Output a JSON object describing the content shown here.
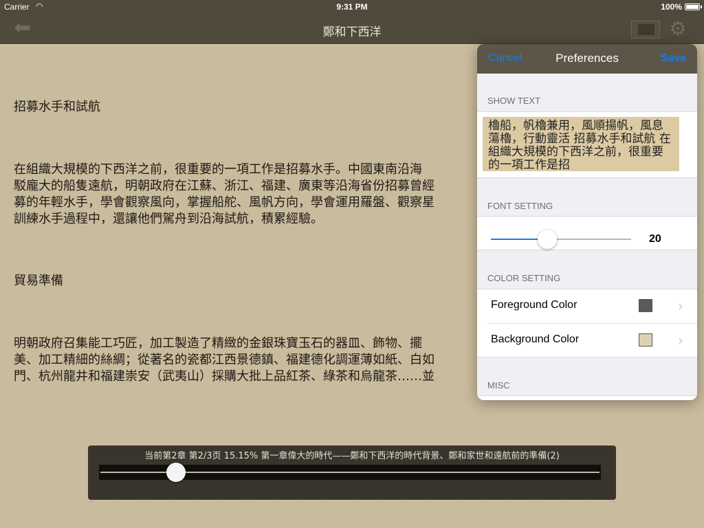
{
  "status_bar": {
    "carrier": "Carrier",
    "time": "9:31 PM",
    "battery": "100%"
  },
  "navbar": {
    "title": "鄭和下西洋"
  },
  "content": {
    "paragraphs": [
      "招募水手和試航",
      "在組織大規模的下西洋之前，很重要的一項工作是招募水手。中國東南沿海",
      "駁龐大的船隻遠航，明朝政府在江蘇、浙江、福建、廣東等沿海省份招募曾經",
      "募的年輕水手，學會觀察風向，掌握船舵、風帆方向，學會運用羅盤、觀察星",
      "訓練水手過程中，還讓他們駕舟到沿海試航，積累經驗。",
      "貿易準備",
      "明朝政府召集能工巧匠，加工製造了精緻的金銀珠寶玉石的器皿、飾物、擺",
      "美、加工精細的絲綢；從著名的瓷都江西景德鎮、福建德化調運薄如紙、白如",
      "門、杭州龍井和福建崇安（武夷山）採購大批上品紅茶、綠茶和烏龍茶……並"
    ]
  },
  "progress": {
    "label": "当前第2章 第2/3页 15.15% 第一章偉大的時代——鄭和下西洋的時代背景、鄭和家世和遠航前的準備(2)",
    "value": 0.1515
  },
  "preferences": {
    "title": "Preferences",
    "cancel_label": "Cancel",
    "save_label": "Save",
    "show_text_header": "SHOW TEXT",
    "preview_text": "櫓船，帆櫓兼用，風順揚帆，風息蕩櫓，行動靈活 招募水手和試航 在組織大規模的下西洋之前，很重要的一項工作是招",
    "font_setting_header": "FONT SETTING",
    "font_size": "20",
    "font_slider_value": 0.4,
    "color_setting_header": "COLOR SETTING",
    "foreground_label": "Foreground Color",
    "foreground_color": "#5a5a5a",
    "background_label": "Background Color",
    "background_color": "#ddd1b4",
    "misc_header": "MISC"
  }
}
